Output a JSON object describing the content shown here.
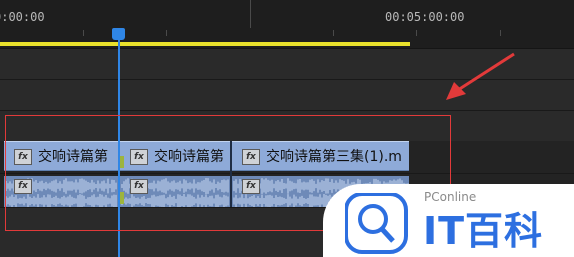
{
  "timeline": {
    "timecode_start": "0:00:00",
    "timecode_mid": "00:05:00:00"
  },
  "clips": {
    "video": [
      {
        "name": "交响诗篇第"
      },
      {
        "name": "交响诗篇第"
      },
      {
        "name": "交响诗篇第三集(1).m"
      }
    ],
    "fx_label": "fx"
  },
  "watermark": {
    "small": "PConline",
    "big": "IT百科"
  },
  "colors": {
    "playhead": "#2f86e6",
    "work_area": "#e9e12c",
    "video_clip": "#8eaad8",
    "audio_clip": "#6e8ab8",
    "annotation": "#e23a3a",
    "watermark_blue": "#2d6fe0"
  }
}
